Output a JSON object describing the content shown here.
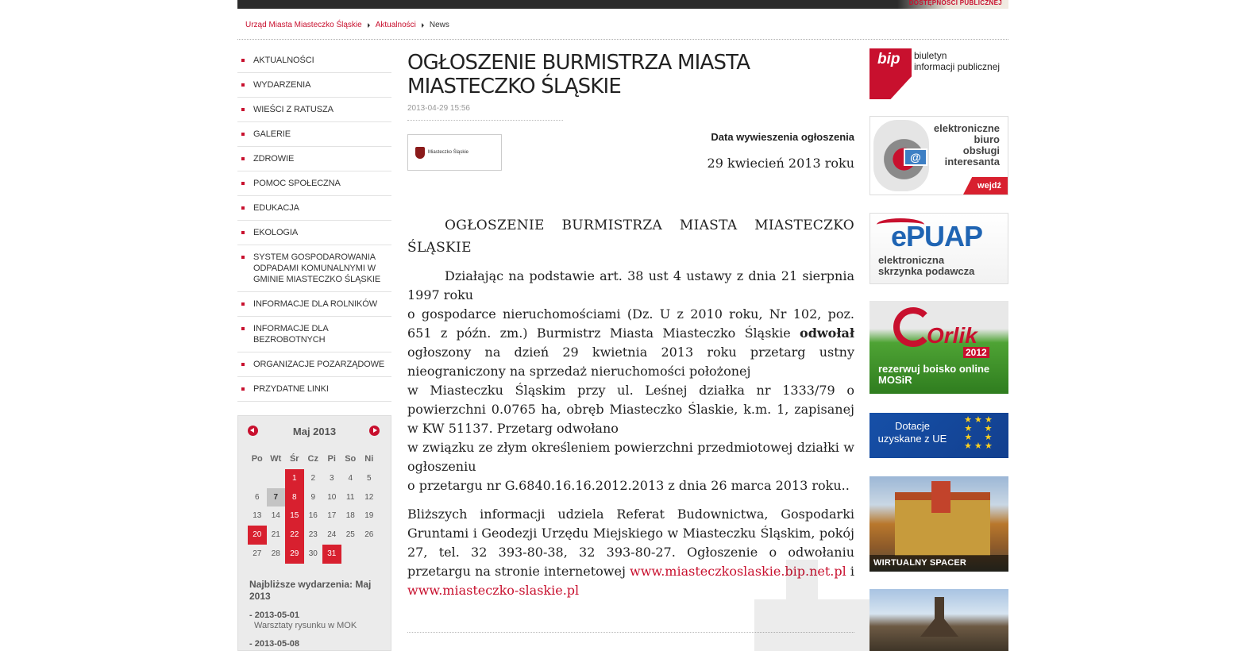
{
  "topbar": {
    "promo_text": "DOSTĘPNOŚCI PUBLICZNEJ"
  },
  "breadcrumb": {
    "items": [
      "Urząd Miasta Miasteczko Śląskie",
      "Aktualności",
      "News"
    ]
  },
  "menu": {
    "items": [
      "AKTUALNOŚCI",
      "WYDARZENIA",
      "WIEŚCI Z RATUSZA",
      "GALERIE",
      "ZDROWIE",
      "POMOC SPOŁECZNA",
      "EDUKACJA",
      "EKOLOGIA",
      "SYSTEM GOSPODAROWANIA ODPADAMI KOMUNALNYMI W GMINIE MIASTECZKO ŚLĄSKIE",
      "INFORMACJE DLA ROLNIKÓW",
      "INFORMACJE DLA BEZROBOTNYCH",
      "ORGANIZACJE POZARZĄDOWE",
      "PRZYDATNE LINKI"
    ]
  },
  "calendar": {
    "title": "Maj 2013",
    "weekdays": [
      "Po",
      "Wt",
      "Śr",
      "Cz",
      "Pi",
      "So",
      "Ni"
    ],
    "weeks": [
      [
        "",
        "",
        "1",
        "2",
        "3",
        "4",
        "5"
      ],
      [
        "6",
        "7",
        "8",
        "9",
        "10",
        "11",
        "12"
      ],
      [
        "13",
        "14",
        "15",
        "16",
        "17",
        "18",
        "19"
      ],
      [
        "20",
        "21",
        "22",
        "23",
        "24",
        "25",
        "26"
      ],
      [
        "27",
        "28",
        "29",
        "30",
        "31",
        "",
        ""
      ]
    ],
    "event_days": [
      "1",
      "8",
      "15",
      "20",
      "22",
      "29",
      "31"
    ],
    "today": "7",
    "upcoming_title": "Najbliższe wydarzenia: Maj 2013",
    "events": [
      {
        "date": "- 2013-05-01",
        "title": "Warsztaty rysunku w MOK"
      },
      {
        "date": "- 2013-05-08",
        "title": ""
      }
    ]
  },
  "article": {
    "title": "OGŁOSZENIE BURMISTRZA MIASTA MIASTECZKO ŚLĄSKIE",
    "date": "2013-04-29 15:56",
    "thumb_label": "Miasteczko Śląskie",
    "posted_label": "Data wywieszenia ogłoszenia",
    "posted_date": "29 kwiecień 2013 roku",
    "heading": "OGŁOSZENIE BURMISTRZA MIASTA MIASTECZKO ŚLĄSKIE",
    "p1_a": "Działając na podstawie art. 38 ust 4 ustawy z dnia 21 sierpnia 1997 roku",
    "p1_b": "o gospodarce nieruchomościami (Dz. U z 2010 roku, Nr 102, poz. 651 z późn. zm.) Burmistrz Miasta Miasteczko Śląskie",
    "p1_bold": "odwołał",
    "p1_c": "ogłoszony na dzień 29 kwietnia 2013 roku przetarg ustny nieograniczony na sprzedaż nieruchomości położonej",
    "p1_d": "w Miasteczku Śląskim przy ul. Leśnej działka nr 1333/79 o powierzchni 0.0765 ha, obręb Miasteczko Ślaskie, k.m. 1, zapisanej w KW 51137. Przetarg odwołano",
    "p1_e": "w związku ze złym określeniem powierzchni przedmiotowej działki w ogłoszeniu",
    "p1_f": "o przetargu nr G.6840.16.16.2012.2013 z dnia 26 marca 2013 roku..",
    "p2_a": "Bliższych informacji udziela Referat Budownictwa, Gospodarki Gruntami i Geodezji Urzędu Miejskiego w Miasteczku Śląskim, pokój 27, tel. 32 393-80-38, 32 393-80-27. Ogłoszenie o odwołaniu przetargu na stronie internetowej",
    "link1": "www.miasteczkoslaskie.bip.net.pl",
    "p2_and": "i",
    "link2": "www.miasteczko-slaskie.pl"
  },
  "banners": {
    "bip": {
      "mark": "bip",
      "line1": "biuletyn",
      "line2": "informacji publicznej"
    },
    "ebiuro": {
      "line1": "elektroniczne",
      "line2": "biuro",
      "line3": "obsługi",
      "line4": "interesanta",
      "button": "wejdź"
    },
    "epuap": {
      "logo": "ePUAP",
      "line1": "elektroniczna",
      "line2": "skrzynka podawcza"
    },
    "orlik": {
      "name": "Orlik",
      "year": "2012",
      "line1": "rezerwuj boisko online",
      "line2": "MOSiR"
    },
    "dotacje": {
      "line1": "Dotacje",
      "line2": "uzyskane z UE"
    },
    "spacer": {
      "label": "WIRTUALNY SPACER"
    }
  },
  "colors": {
    "accent": "#c8102e",
    "event_day": "#d8202f",
    "topbar": "#2b2b2b"
  }
}
